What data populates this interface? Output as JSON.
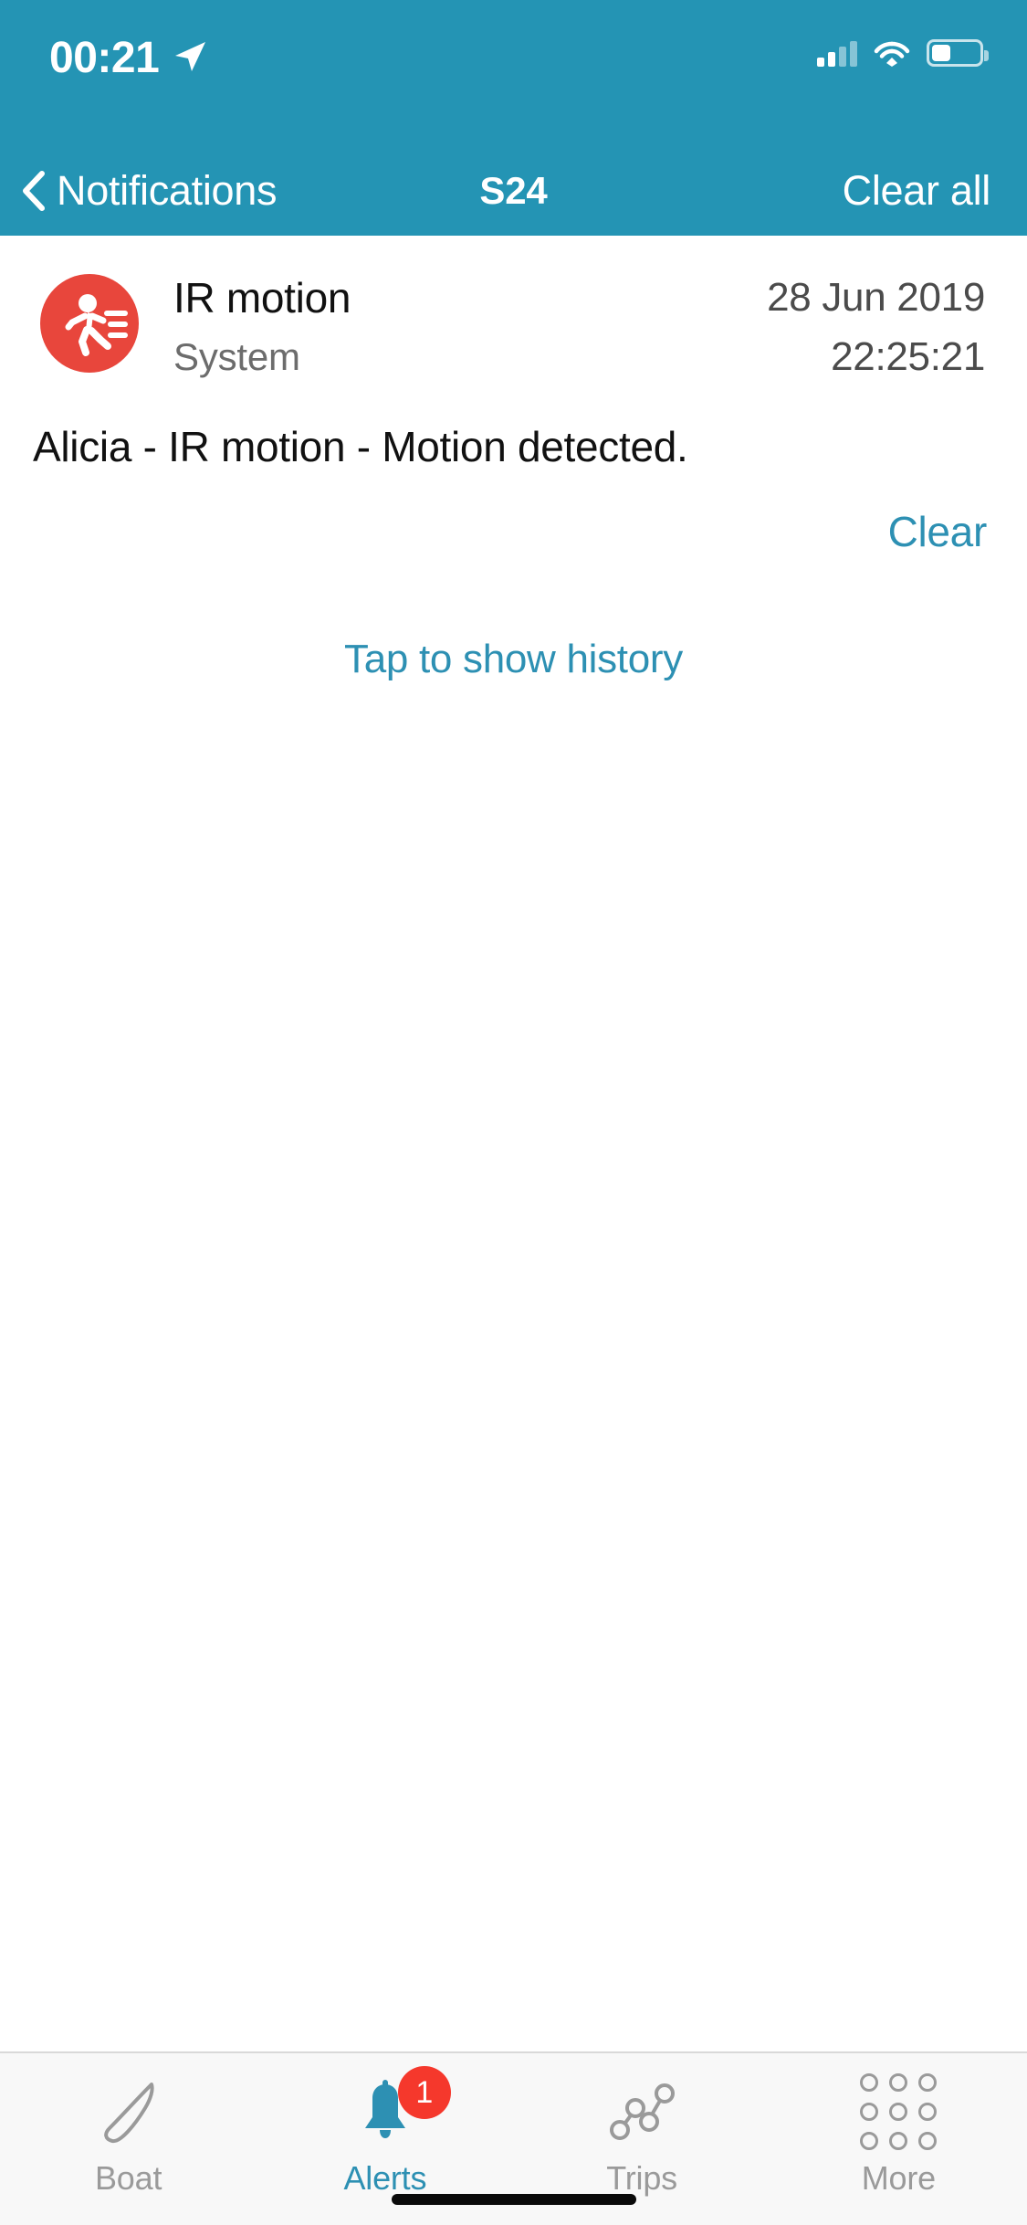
{
  "status_bar": {
    "time": "00:21",
    "location_icon": "location-arrow-icon",
    "signal_icon": "cellular-signal-icon",
    "wifi_icon": "wifi-icon",
    "battery_icon": "battery-icon",
    "battery_level_percent": 36
  },
  "nav_bar": {
    "back_label": "Notifications",
    "back_icon": "chevron-left-icon",
    "title": "S24",
    "action_label": "Clear all",
    "background_color": "#2494b4",
    "text_color": "#ffffff"
  },
  "notification": {
    "icon_name": "running-person-motion-icon",
    "icon_background_color": "#e8463c",
    "title": "IR motion",
    "source": "System",
    "date": "28 Jun 2019",
    "time": "22:25:21",
    "body": "Alicia - IR motion - Motion detected.",
    "clear_label": "Clear",
    "clear_color": "#2d90b3"
  },
  "history": {
    "label": "Tap to show history",
    "color": "#2d90b3"
  },
  "tab_bar": {
    "active_color": "#2d90b3",
    "inactive_color": "#9a9a9a",
    "badge_color": "#f5382c",
    "items": [
      {
        "label": "Boat",
        "icon": "boat-hull-icon",
        "active": false,
        "badge": ""
      },
      {
        "label": "Alerts",
        "icon": "bell-icon",
        "active": true,
        "badge": "1"
      },
      {
        "label": "Trips",
        "icon": "trip-route-nodes-icon",
        "active": false,
        "badge": ""
      },
      {
        "label": "More",
        "icon": "grid-dots-icon",
        "active": false,
        "badge": ""
      }
    ]
  }
}
